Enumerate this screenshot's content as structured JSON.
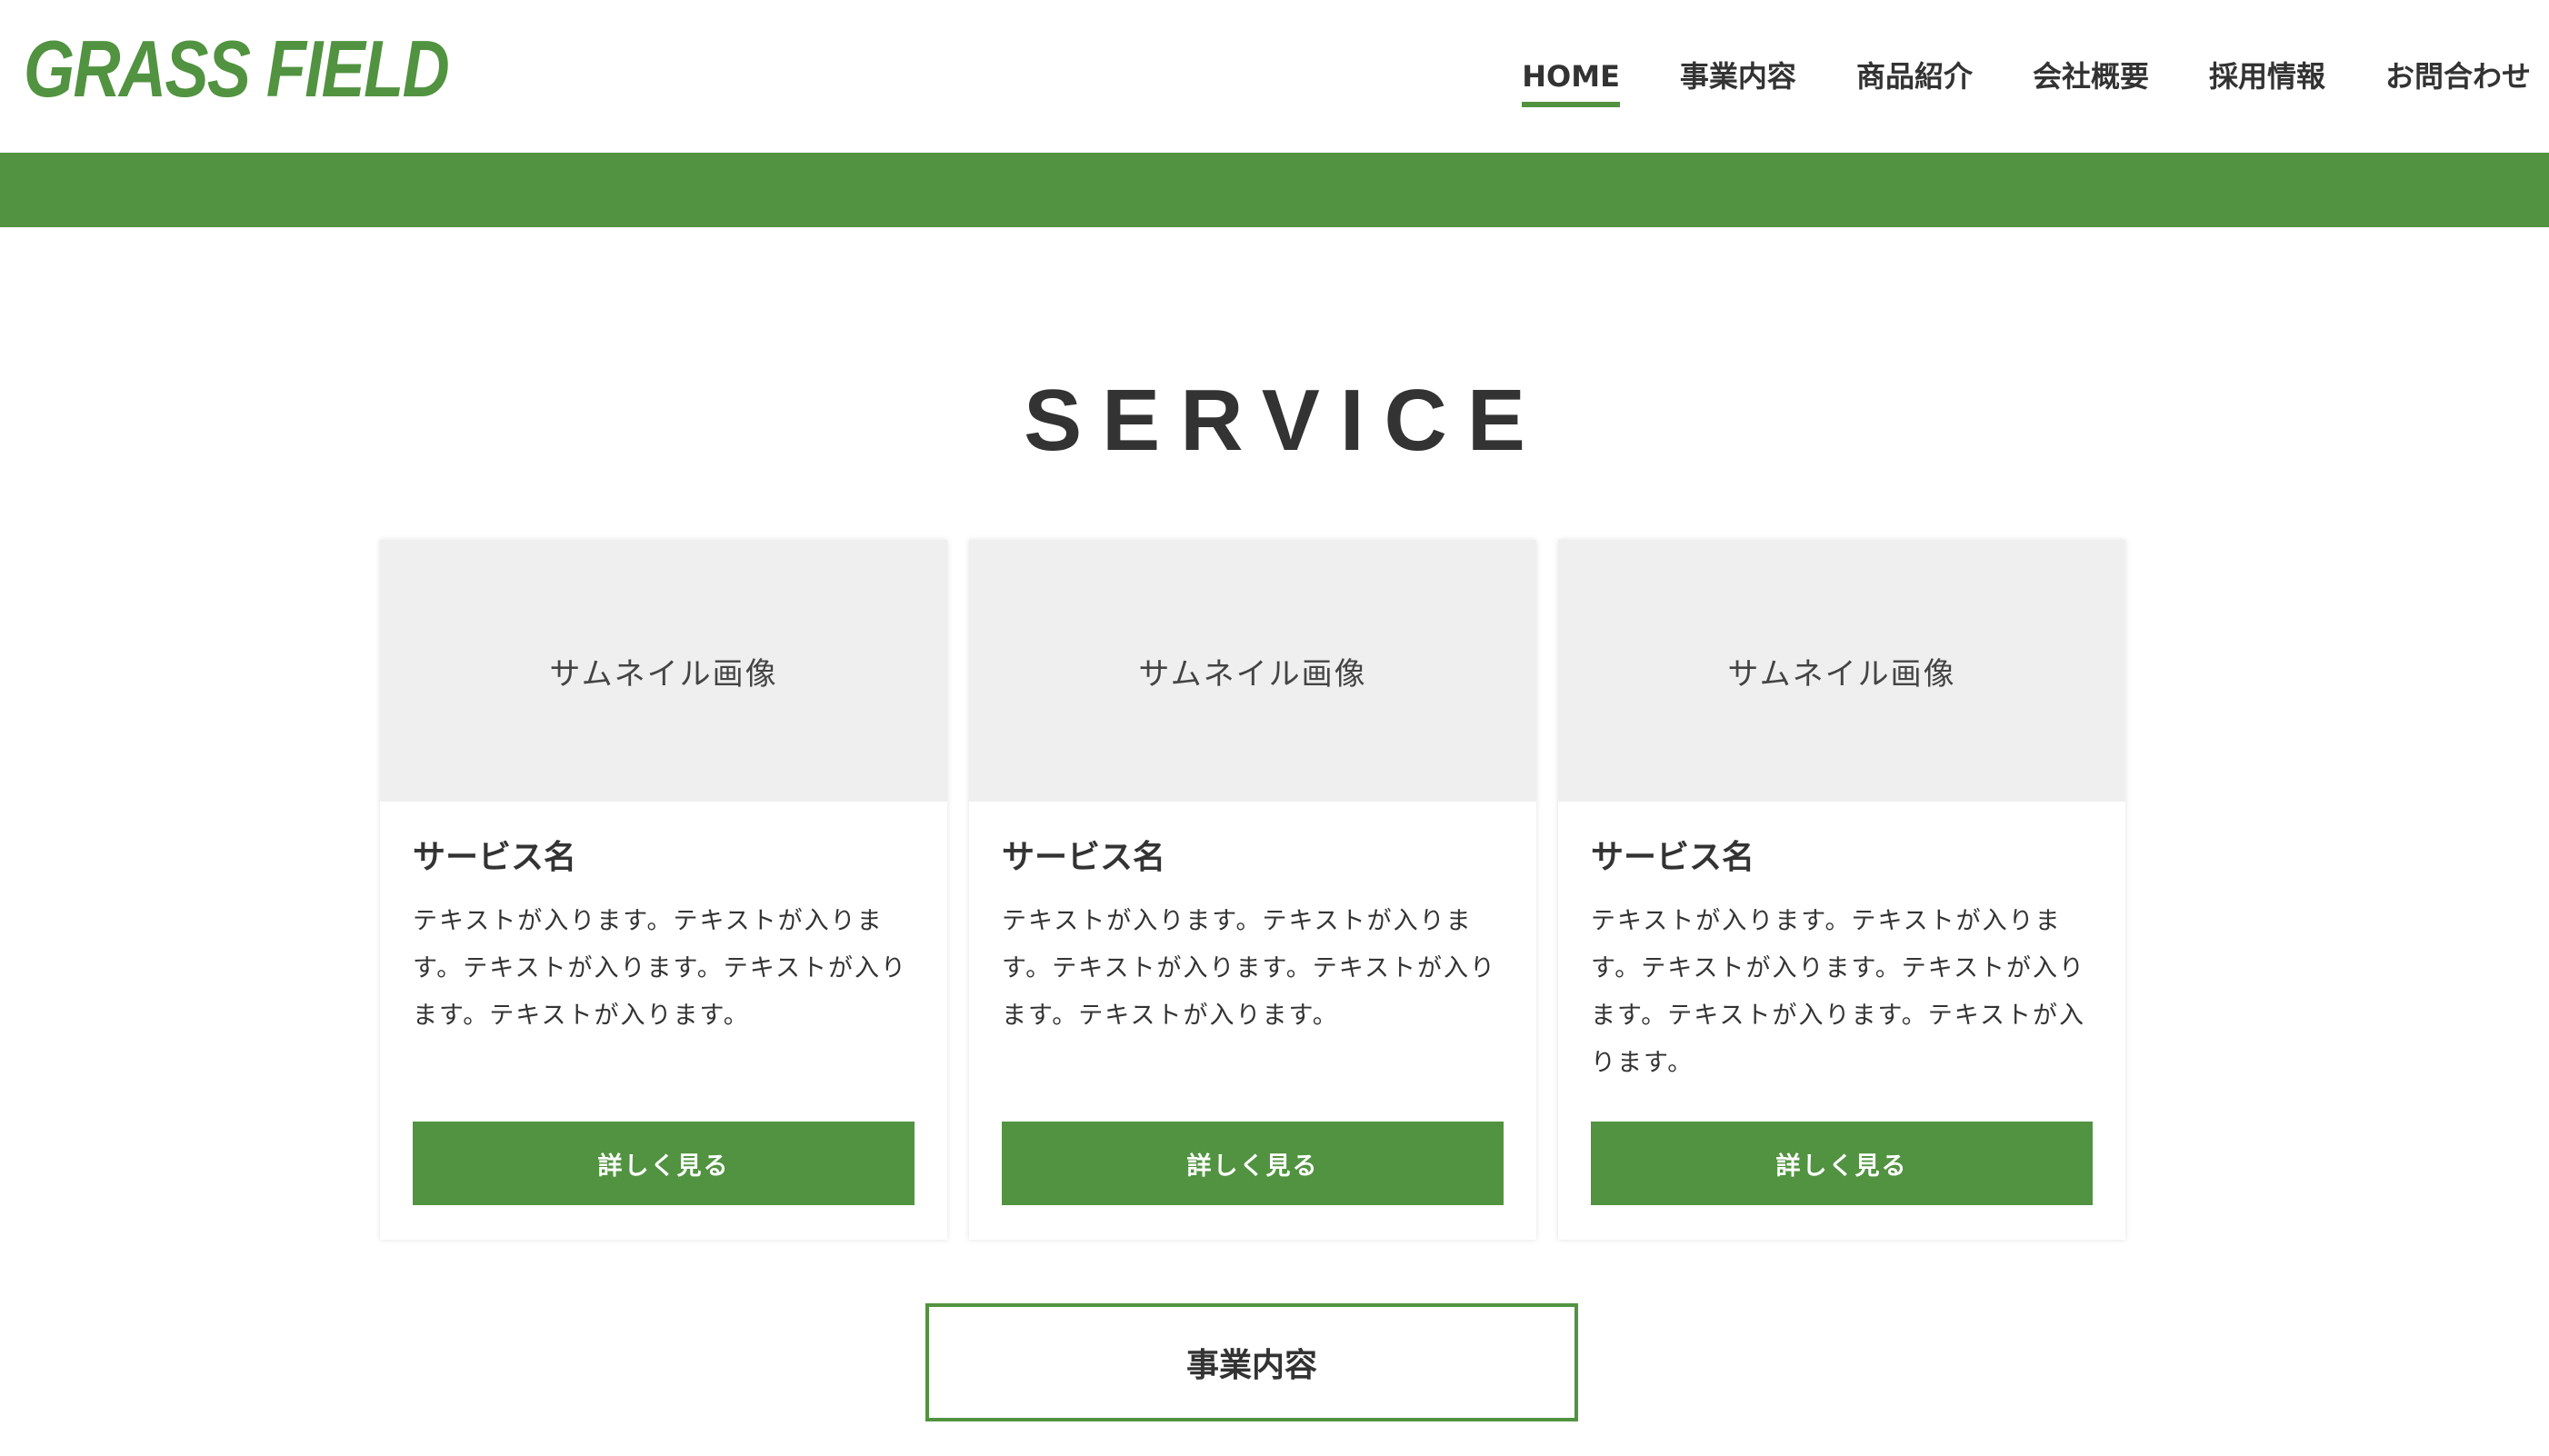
{
  "colors": {
    "brand_green": "#519340",
    "text_dark": "#333333",
    "thumb_bg": "#efefef"
  },
  "header": {
    "logo_text": "GRASS FIELD",
    "nav": [
      {
        "label": "HOME",
        "active": true
      },
      {
        "label": "事業内容",
        "active": false
      },
      {
        "label": "商品紹介",
        "active": false
      },
      {
        "label": "会社概要",
        "active": false
      },
      {
        "label": "採用情報",
        "active": false
      },
      {
        "label": "お問合わせ",
        "active": false
      }
    ]
  },
  "service": {
    "title": "SERVICE",
    "cards": [
      {
        "thumbnail_label": "サムネイル画像",
        "title": "サービス名",
        "text": "テキストが入ります。テキストが入ります。テキストが入ります。テキストが入ります。テキストが入ります。",
        "button_label": "詳しく見る"
      },
      {
        "thumbnail_label": "サムネイル画像",
        "title": "サービス名",
        "text": "テキストが入ります。テキストが入ります。テキストが入ります。テキストが入ります。テキストが入ります。",
        "button_label": "詳しく見る"
      },
      {
        "thumbnail_label": "サムネイル画像",
        "title": "サービス名",
        "text": "テキストが入ります。テキストが入ります。テキストが入ります。テキストが入ります。テキストが入ります。テキストが入ります。",
        "button_label": "詳しく見る"
      }
    ],
    "more_button_label": "事業内容"
  }
}
